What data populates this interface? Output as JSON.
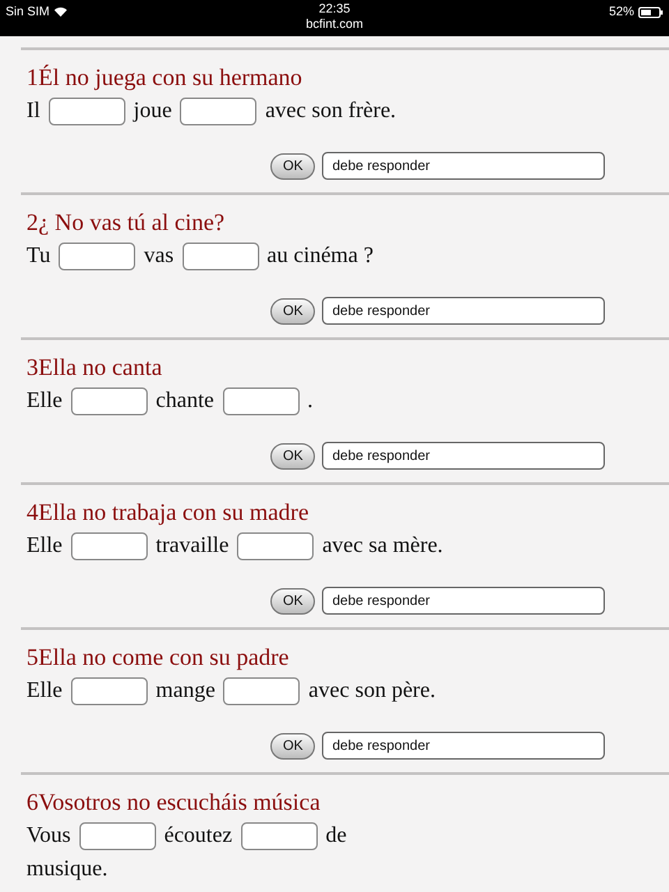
{
  "status_bar": {
    "carrier": "Sin SIM",
    "time": "22:35",
    "url": "bcfint.com",
    "battery": "52%"
  },
  "exercises": [
    {
      "title": "1Él no juega con su hermano",
      "lines": [
        [
          {
            "kind": "text",
            "text": "Il"
          },
          {
            "kind": "blank"
          },
          {
            "kind": "text",
            "text": "joue"
          },
          {
            "kind": "blank"
          },
          {
            "kind": "text",
            "text": "avec son frère."
          }
        ]
      ],
      "button": "OK",
      "answer": "debe responder"
    },
    {
      "title": "2¿ No vas tú al cine?",
      "lines": [
        [
          {
            "kind": "text",
            "text": "Tu"
          },
          {
            "kind": "blank"
          },
          {
            "kind": "text",
            "text": "vas"
          },
          {
            "kind": "blank"
          },
          {
            "kind": "text",
            "text": "au cinéma ?"
          }
        ]
      ],
      "button": "OK",
      "answer": "debe responder"
    },
    {
      "title": "3Ella no canta",
      "lines": [
        [
          {
            "kind": "text",
            "text": "Elle"
          },
          {
            "kind": "blank"
          },
          {
            "kind": "text",
            "text": "chante"
          },
          {
            "kind": "blank"
          },
          {
            "kind": "text",
            "text": "."
          }
        ]
      ],
      "button": "OK",
      "answer": "debe responder"
    },
    {
      "title": "4Ella no trabaja con su madre",
      "lines": [
        [
          {
            "kind": "text",
            "text": "Elle"
          },
          {
            "kind": "blank"
          },
          {
            "kind": "text",
            "text": "travaille"
          },
          {
            "kind": "blank"
          },
          {
            "kind": "text",
            "text": "avec sa mère."
          }
        ]
      ],
      "button": "OK",
      "answer": "debe responder"
    },
    {
      "title": "5Ella no come con su padre",
      "lines": [
        [
          {
            "kind": "text",
            "text": "Elle"
          },
          {
            "kind": "blank"
          },
          {
            "kind": "text",
            "text": "mange"
          },
          {
            "kind": "blank"
          },
          {
            "kind": "text",
            "text": "avec son père."
          }
        ]
      ],
      "button": "OK",
      "answer": "debe responder"
    },
    {
      "title": "6Vosotros no escucháis música",
      "lines": [
        [
          {
            "kind": "text",
            "text": "Vous"
          },
          {
            "kind": "blank"
          },
          {
            "kind": "text",
            "text": "écoutez"
          },
          {
            "kind": "blank"
          },
          {
            "kind": "text",
            "text": "de"
          }
        ],
        [
          {
            "kind": "text",
            "text": "musique."
          }
        ]
      ]
    }
  ]
}
